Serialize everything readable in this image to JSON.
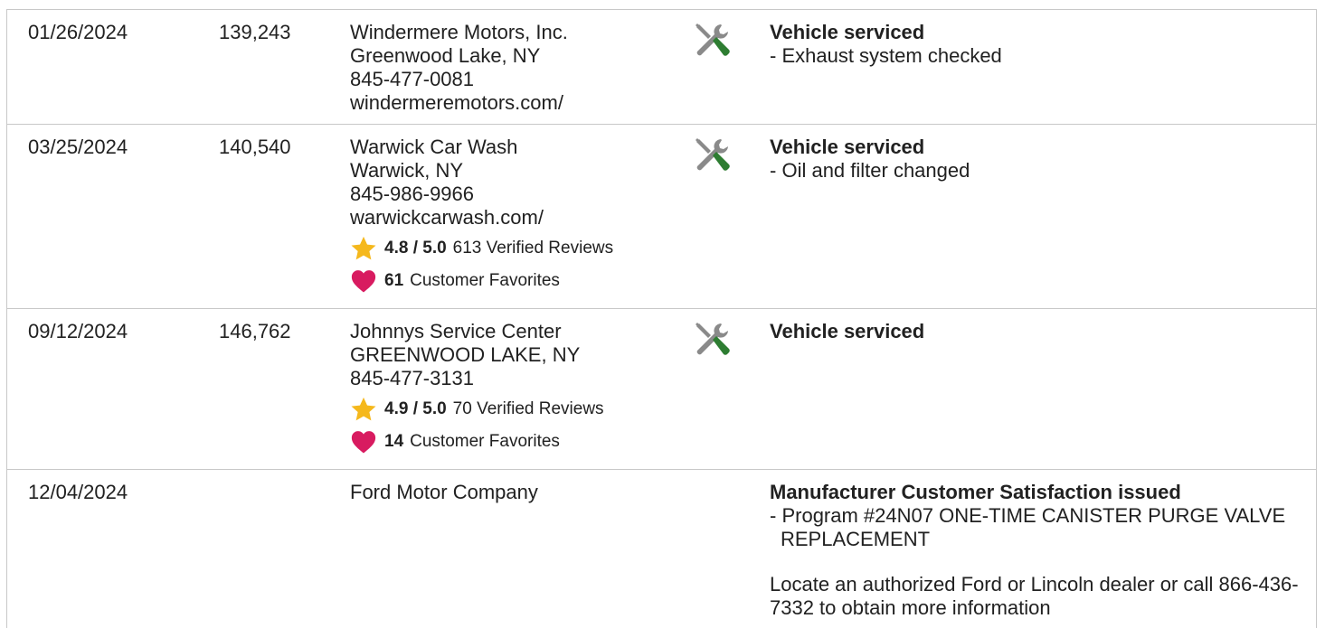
{
  "rows": [
    {
      "date": "01/26/2024",
      "mileage": "139,243",
      "source": [
        "Windermere Motors, Inc.",
        "Greenwood Lake, NY",
        "845-477-0081",
        "windermeremotors.com/"
      ],
      "icon": "wrench-screwdriver-icon",
      "detail_title": "Vehicle serviced",
      "detail_items": [
        "Exhaust system checked"
      ]
    },
    {
      "date": "03/25/2024",
      "mileage": "140,540",
      "source": [
        "Warwick Car Wash",
        "Warwick, NY",
        "845-986-9966",
        "warwickcarwash.com/"
      ],
      "rating": {
        "score": "4.8 / 5.0",
        "reviews": "613 Verified Reviews"
      },
      "favorites": {
        "count": "61",
        "label": "Customer Favorites"
      },
      "icon": "wrench-screwdriver-icon",
      "detail_title": "Vehicle serviced",
      "detail_items": [
        "Oil and filter changed"
      ]
    },
    {
      "date": "09/12/2024",
      "mileage": "146,762",
      "source": [
        "Johnnys Service Center",
        "GREENWOOD LAKE, NY",
        "845-477-3131"
      ],
      "rating": {
        "score": "4.9 / 5.0",
        "reviews": "70 Verified Reviews"
      },
      "favorites": {
        "count": "14",
        "label": "Customer Favorites"
      },
      "icon": "wrench-screwdriver-icon",
      "detail_title": "Vehicle serviced",
      "detail_items": []
    },
    {
      "date": "12/04/2024",
      "mileage": "",
      "source": [
        "Ford Motor Company"
      ],
      "detail_title": "Manufacturer Customer Satisfaction issued",
      "detail_items": [
        "Program #24N07 ONE-TIME CANISTER PURGE VALVE REPLACEMENT"
      ],
      "detail_note": "Locate an authorized Ford or Lincoln dealer or call 866-436-7332 to obtain more information"
    }
  ],
  "colors": {
    "star": "#F5B81C",
    "heart": "#D81B60",
    "tool_gray": "#8a8a8a",
    "tool_green": "#2E7D32",
    "border": "#c8c8c8"
  }
}
